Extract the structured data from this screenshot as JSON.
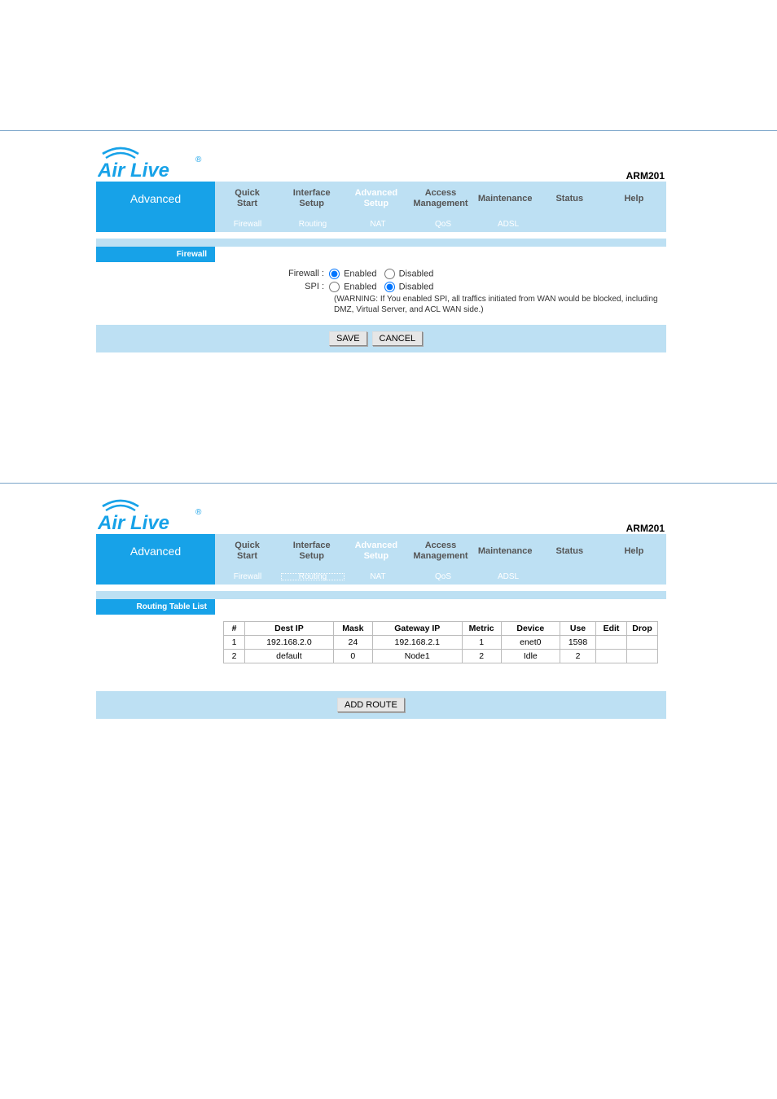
{
  "brand_text": "Air Live",
  "model": "ARM201",
  "tabs": {
    "quick_start": "Quick\nStart",
    "interface_setup": "Interface\nSetup",
    "advanced_setup": "Advanced\nSetup",
    "access_mgmt": "Access\nManagement",
    "maintenance": "Maintenance",
    "status": "Status",
    "help": "Help"
  },
  "left_title": "Advanced",
  "subtabs": {
    "firewall": "Firewall",
    "routing": "Routing",
    "nat": "NAT",
    "qos": "QoS",
    "adsl": "ADSL"
  },
  "panel1": {
    "section": "Firewall",
    "firewall_label": "Firewall :",
    "spi_label": "SPI :",
    "enabled": "Enabled",
    "disabled": "Disabled",
    "warning": "(WARNING: If You enabled SPI, all traffics initiated from WAN would be blocked, including DMZ, Virtual Server, and ACL WAN side.)",
    "save": "SAVE",
    "cancel": "CANCEL"
  },
  "panel2": {
    "section": "Routing Table List",
    "add_route": "ADD ROUTE",
    "headers": {
      "num": "#",
      "dest_ip": "Dest IP",
      "mask": "Mask",
      "gateway": "Gateway IP",
      "metric": "Metric",
      "device": "Device",
      "use": "Use",
      "edit": "Edit",
      "drop": "Drop"
    },
    "rows": [
      {
        "num": "1",
        "dest_ip": "192.168.2.0",
        "mask": "24",
        "gateway": "192.168.2.1",
        "metric": "1",
        "device": "enet0",
        "use": "1598",
        "edit": "",
        "drop": ""
      },
      {
        "num": "2",
        "dest_ip": "default",
        "mask": "0",
        "gateway": "Node1",
        "metric": "2",
        "device": "Idle",
        "use": "2",
        "edit": "",
        "drop": ""
      }
    ]
  }
}
